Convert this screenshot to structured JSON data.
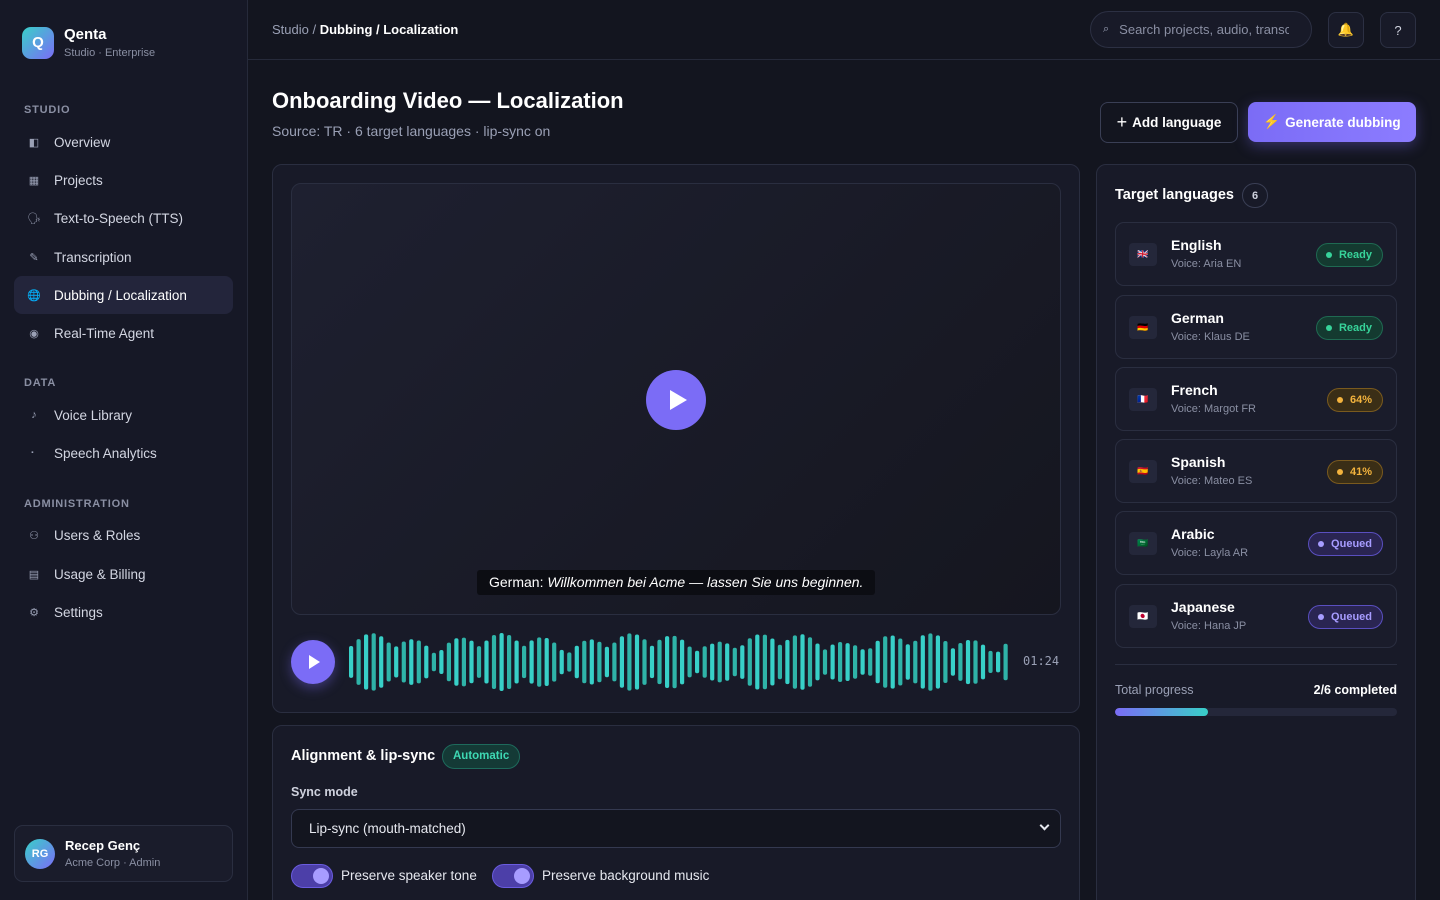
{
  "app": {
    "name": "Qenta",
    "subtitle": "Studio · Enterprise",
    "logo_letter": "Q"
  },
  "sidebar": {
    "sections": [
      {
        "label": "STUDIO"
      },
      {
        "label": "DATA"
      },
      {
        "label": "ADMINISTRATION"
      }
    ],
    "items": [
      {
        "label": "Overview",
        "icon": "overview-icon",
        "glyph": "◧"
      },
      {
        "label": "Projects",
        "icon": "projects-icon",
        "glyph": "▦"
      },
      {
        "label": "Text-to-Speech (TTS)",
        "icon": "speech-icon",
        "glyph": "🗣"
      },
      {
        "label": "Transcription",
        "icon": "pen-icon",
        "glyph": "✎"
      },
      {
        "label": "Dubbing / Localization",
        "icon": "globe-icon",
        "glyph": "🌐",
        "active": true
      },
      {
        "label": "Real-Time Agent",
        "icon": "radio-icon",
        "glyph": "◉"
      },
      {
        "label": "Voice Library",
        "icon": "music-note-icon",
        "glyph": "♪"
      },
      {
        "label": "Speech Analytics",
        "icon": "analytics-icon",
        "glyph": "⠂"
      },
      {
        "label": "Users & Roles",
        "icon": "users-icon",
        "glyph": "⚇"
      },
      {
        "label": "Usage & Billing",
        "icon": "billing-icon",
        "glyph": "▤"
      },
      {
        "label": "Settings",
        "icon": "gear-icon",
        "glyph": "⚙"
      }
    ]
  },
  "user": {
    "initials": "RG",
    "name": "Recep Genç",
    "org": "Acme Corp · Admin"
  },
  "topbar": {
    "breadcrumb_root": "Studio / ",
    "breadcrumb_current": "Dubbing / Localization",
    "search_placeholder": "Search projects, audio, transcripts",
    "bell_glyph": "🔔",
    "help_glyph": "?"
  },
  "header": {
    "title": "Onboarding Video — Localization",
    "subtitle": "Source: TR · 6 target languages · lip-sync on",
    "add_language_plus": "+",
    "add_language": "Add language",
    "generate_bolt": "⚡",
    "generate": "Generate dubbing"
  },
  "player": {
    "subtitle_lang": "German:",
    "subtitle_text": "Willkommen bei Acme — lassen Sie uns beginnen.",
    "duration": "01:24"
  },
  "alignment": {
    "title": "Alignment & lip-sync",
    "tag": "Automatic",
    "sync_mode_label": "Sync mode",
    "sync_mode_value": "Lip-sync (mouth-matched)",
    "toggles": [
      {
        "label": "Preserve speaker tone",
        "on": true
      },
      {
        "label": "Preserve background music",
        "on": true
      }
    ]
  },
  "languages": {
    "title": "Target languages",
    "count": "6",
    "items": [
      {
        "name": "English",
        "voice": "Voice: Aria EN",
        "flag": "🇬🇧",
        "status": "Ready",
        "kind": "ready"
      },
      {
        "name": "German",
        "voice": "Voice: Klaus DE",
        "flag": "🇩🇪",
        "status": "Ready",
        "kind": "ready"
      },
      {
        "name": "French",
        "voice": "Voice: Margot FR",
        "flag": "🇫🇷",
        "status": "64%",
        "kind": "prog"
      },
      {
        "name": "Spanish",
        "voice": "Voice: Mateo ES",
        "flag": "🇪🇸",
        "status": "41%",
        "kind": "prog"
      },
      {
        "name": "Arabic",
        "voice": "Voice: Layla AR",
        "flag": "🇸🇦",
        "status": "Queued",
        "kind": "queue"
      },
      {
        "name": "Japanese",
        "voice": "Voice: Hana JP",
        "flag": "🇯🇵",
        "status": "Queued",
        "kind": "queue"
      }
    ],
    "total_label": "Total progress",
    "total_value": "2/6 completed",
    "total_fraction": 0.33
  },
  "colors": {
    "accent": "#7b6cf6",
    "teal": "#38d0c8",
    "ready": "#37d39a",
    "progress": "#f3b33d",
    "queued": "#a79cff"
  }
}
